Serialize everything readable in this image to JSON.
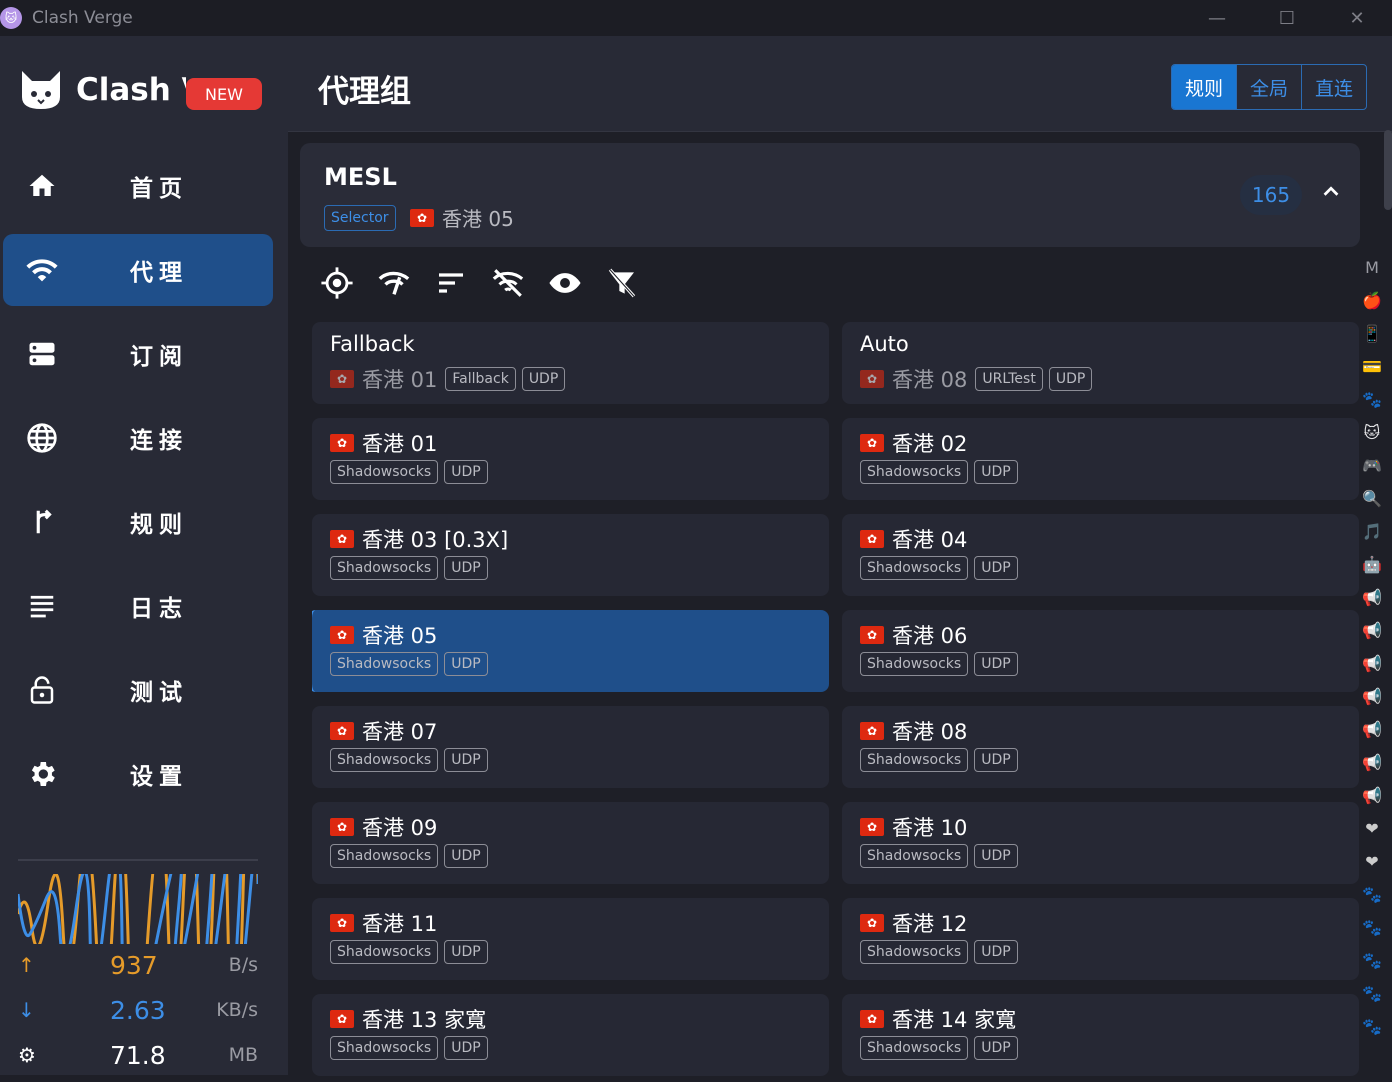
{
  "window": {
    "title": "Clash Verge",
    "minimize": "—",
    "maximize": "☐",
    "close": "✕"
  },
  "sidebar": {
    "logo_text": "Clash Verge",
    "new_badge": "NEW",
    "items": [
      {
        "label": "首页",
        "icon": "home-icon"
      },
      {
        "label": "代理",
        "icon": "wifi-icon",
        "active": true
      },
      {
        "label": "订阅",
        "icon": "storage-icon"
      },
      {
        "label": "连接",
        "icon": "globe-icon"
      },
      {
        "label": "规则",
        "icon": "fork-icon"
      },
      {
        "label": "日志",
        "icon": "list-icon"
      },
      {
        "label": "测试",
        "icon": "lock-icon"
      },
      {
        "label": "设置",
        "icon": "gear-icon"
      }
    ],
    "traffic": {
      "upload": {
        "value": "937",
        "unit": "B/s",
        "color": "#e59b2a"
      },
      "download": {
        "value": "2.63",
        "unit": "KB/s",
        "color": "#3d8ee6"
      },
      "memory": {
        "value": "71.8",
        "unit": "MB"
      }
    }
  },
  "header": {
    "title": "代理组",
    "modes": [
      {
        "label": "规则",
        "active": true
      },
      {
        "label": "全局"
      },
      {
        "label": "直连"
      }
    ]
  },
  "group": {
    "name": "MESL",
    "type": "Selector",
    "current": "香港 05",
    "count": "165"
  },
  "proxies": [
    {
      "name": "Fallback",
      "sub": "香港 01",
      "tags": [
        "Fallback",
        "UDP"
      ],
      "group": true
    },
    {
      "name": "Auto",
      "sub": "香港 08",
      "tags": [
        "URLTest",
        "UDP"
      ],
      "group": true
    },
    {
      "name": "香港 01",
      "tags": [
        "Shadowsocks",
        "UDP"
      ]
    },
    {
      "name": "香港 02",
      "tags": [
        "Shadowsocks",
        "UDP"
      ]
    },
    {
      "name": "香港 03 [0.3X]",
      "tags": [
        "Shadowsocks",
        "UDP"
      ]
    },
    {
      "name": "香港 04",
      "tags": [
        "Shadowsocks",
        "UDP"
      ]
    },
    {
      "name": "香港 05",
      "tags": [
        "Shadowsocks",
        "UDP"
      ],
      "selected": true
    },
    {
      "name": "香港 06",
      "tags": [
        "Shadowsocks",
        "UDP"
      ]
    },
    {
      "name": "香港 07",
      "tags": [
        "Shadowsocks",
        "UDP"
      ]
    },
    {
      "name": "香港 08",
      "tags": [
        "Shadowsocks",
        "UDP"
      ]
    },
    {
      "name": "香港 09",
      "tags": [
        "Shadowsocks",
        "UDP"
      ]
    },
    {
      "name": "香港 10",
      "tags": [
        "Shadowsocks",
        "UDP"
      ]
    },
    {
      "name": "香港 11",
      "tags": [
        "Shadowsocks",
        "UDP"
      ]
    },
    {
      "name": "香港 12",
      "tags": [
        "Shadowsocks",
        "UDP"
      ]
    },
    {
      "name": "香港 13 家寬",
      "tags": [
        "Shadowsocks",
        "UDP"
      ]
    },
    {
      "name": "香港 14 家寬",
      "tags": [
        "Shadowsocks",
        "UDP"
      ]
    }
  ],
  "index_bar": [
    "M",
    "🍎",
    "📱",
    "💳",
    "🐾",
    "🐱",
    "🎮",
    "🔍",
    "🎵",
    "🤖",
    "📢",
    "📢",
    "📢",
    "📢",
    "📢",
    "📢",
    "📢",
    "❤",
    "❤",
    "🐾",
    "🐾",
    "🐾",
    "🐾",
    "🐾"
  ]
}
